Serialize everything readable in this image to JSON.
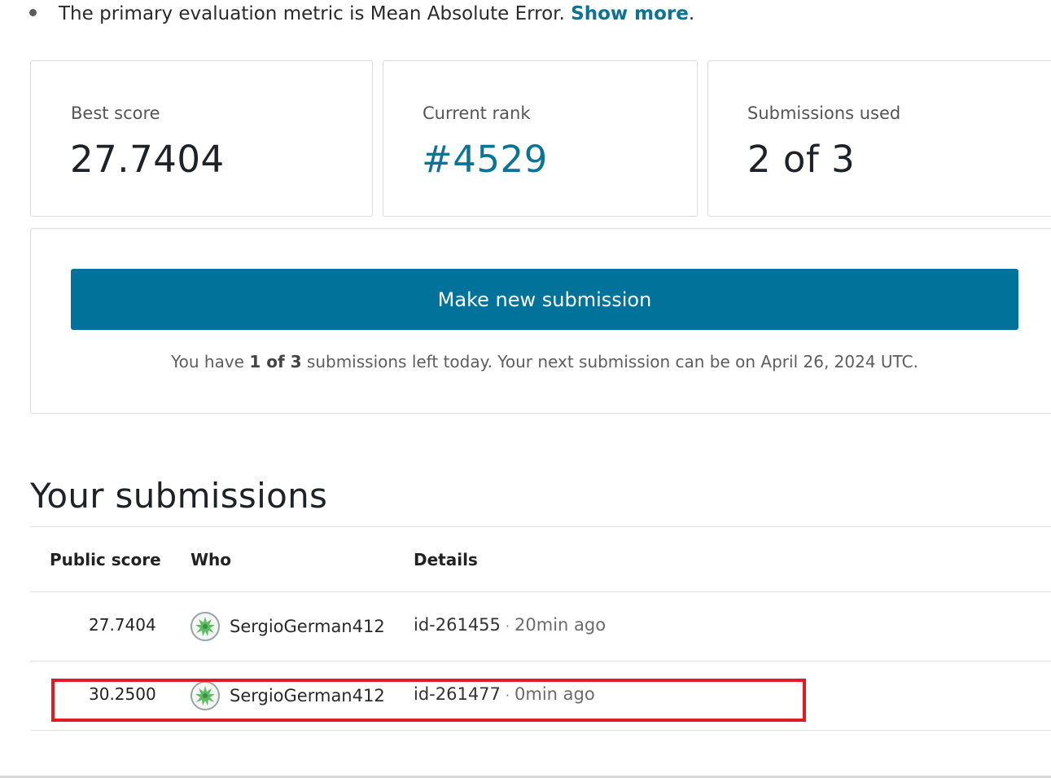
{
  "intro": {
    "metric_text": "The primary evaluation metric is Mean Absolute Error.",
    "show_more": "Show more",
    "period": "."
  },
  "stats": {
    "best_score_label": "Best score",
    "best_score_value": "27.7404",
    "current_rank_label": "Current rank",
    "current_rank_value": "#4529",
    "submissions_used_label": "Submissions used",
    "submissions_used_value": "2 of 3"
  },
  "submit_panel": {
    "button_label": "Make new submission",
    "note_prefix": "You have",
    "note_count": "1 of 3",
    "note_suffix": "submissions left today. Your next submission can be on April 26, 2024 UTC."
  },
  "submissions": {
    "title": "Your submissions",
    "columns": [
      "Public score",
      "Who",
      "Details"
    ],
    "rows": [
      {
        "score": "27.7404",
        "who": "SergioGerman412",
        "id": "id-261455",
        "sep": "·",
        "time": "20min ago"
      },
      {
        "score": "30.2500",
        "who": "SergioGerman412",
        "id": "id-261477",
        "sep": "·",
        "time": "0min ago"
      }
    ]
  },
  "colors": {
    "accent": "#01739a",
    "link": "#0a7396",
    "highlight": "#e01b24",
    "avatar_leaf": "#5dbb63"
  }
}
